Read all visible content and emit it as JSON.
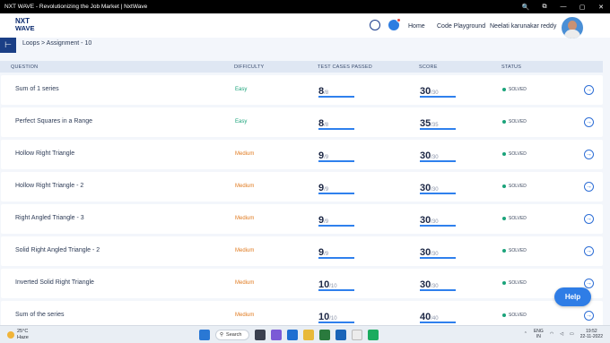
{
  "window": {
    "title": "NXT WAVE - Revolutionizing the Job Market | NxtWave",
    "controls": [
      "🔍",
      "⧉",
      "—",
      "▢",
      "✕"
    ]
  },
  "header": {
    "logo_line1": "NXT",
    "logo_line2": "WAVE",
    "nav": {
      "home": "Home",
      "code_playground": "Code Playground",
      "user": "Neelati karunakar reddy"
    }
  },
  "breadcrumb": "Loops > Assignment - 10",
  "columns": {
    "question": "QUESTION",
    "difficulty": "DIFFICULTY",
    "test_cases": "TEST CASES PASSED",
    "score": "SCORE",
    "status": "STATUS"
  },
  "rows": [
    {
      "question": "Sum of 1 series",
      "difficulty": "Easy",
      "level": "easy",
      "passed": "8",
      "total": "/8",
      "score": "30",
      "max": "/30",
      "status": "SOLVED"
    },
    {
      "question": "Perfect Squares in a Range",
      "difficulty": "Easy",
      "level": "easy",
      "passed": "8",
      "total": "/8",
      "score": "35",
      "max": "/35",
      "status": "SOLVED"
    },
    {
      "question": "Hollow Right Triangle",
      "difficulty": "Medium",
      "level": "medium",
      "passed": "9",
      "total": "/9",
      "score": "30",
      "max": "/30",
      "status": "SOLVED"
    },
    {
      "question": "Hollow Right Triangle - 2",
      "difficulty": "Medium",
      "level": "medium",
      "passed": "9",
      "total": "/9",
      "score": "30",
      "max": "/30",
      "status": "SOLVED"
    },
    {
      "question": "Right Angled Triangle - 3",
      "difficulty": "Medium",
      "level": "medium",
      "passed": "9",
      "total": "/9",
      "score": "30",
      "max": "/30",
      "status": "SOLVED"
    },
    {
      "question": "Solid Right Angled Triangle - 2",
      "difficulty": "Medium",
      "level": "medium",
      "passed": "9",
      "total": "/9",
      "score": "30",
      "max": "/30",
      "status": "SOLVED"
    },
    {
      "question": "Inverted Solid Right Triangle",
      "difficulty": "Medium",
      "level": "medium",
      "passed": "10",
      "total": "/10",
      "score": "30",
      "max": "/30",
      "status": "SOLVED"
    },
    {
      "question": "Sum of the series",
      "difficulty": "Medium",
      "level": "medium",
      "passed": "10",
      "total": "/10",
      "score": "40",
      "max": "/40",
      "status": "SOLVED"
    }
  ],
  "help_label": "Help",
  "taskbar": {
    "weather_temp": "25°C",
    "weather_desc": "Haze",
    "search_label": "Search",
    "lang_line1": "ENG",
    "lang_line2": "IN",
    "time": "19:52",
    "date": "22-11-2022"
  }
}
